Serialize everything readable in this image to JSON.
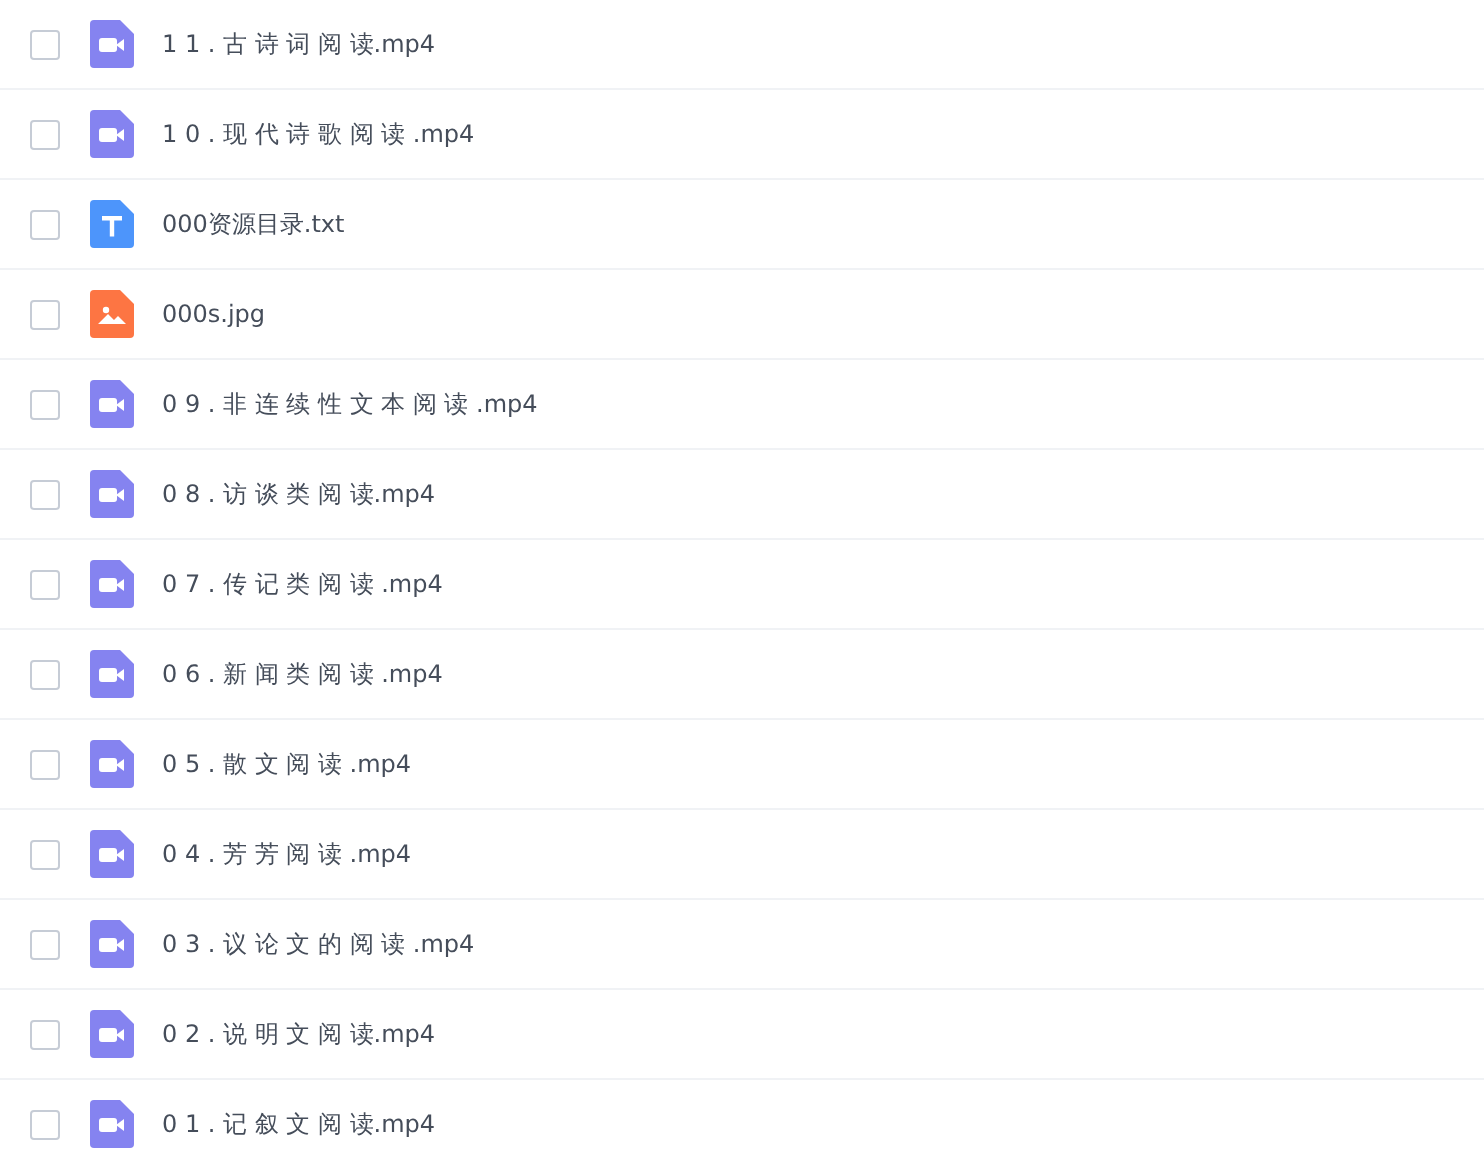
{
  "files": [
    {
      "name": "1 1 . 古 诗 词 阅 读.mp4",
      "kind": "video",
      "checked": false
    },
    {
      "name": "1 0 . 现 代 诗 歌 阅 读 .mp4",
      "kind": "video",
      "checked": false
    },
    {
      "name": "000资源目录.txt",
      "kind": "text",
      "checked": false
    },
    {
      "name": "000s.jpg",
      "kind": "image",
      "checked": false
    },
    {
      "name": "0 9 . 非 连 续 性 文 本 阅 读 .mp4",
      "kind": "video",
      "checked": false
    },
    {
      "name": "0 8 . 访 谈 类 阅 读.mp4",
      "kind": "video",
      "checked": false
    },
    {
      "name": "0 7 . 传 记 类 阅 读 .mp4",
      "kind": "video",
      "checked": false
    },
    {
      "name": "0 6 . 新 闻 类 阅 读 .mp4",
      "kind": "video",
      "checked": false
    },
    {
      "name": "0 5 . 散 文 阅 读 .mp4",
      "kind": "video",
      "checked": false
    },
    {
      "name": "0 4 . 芳 芳 阅 读 .mp4",
      "kind": "video",
      "checked": false
    },
    {
      "name": "0 3 . 议 论 文 的 阅 读 .mp4",
      "kind": "video",
      "checked": false
    },
    {
      "name": "0 2 . 说 明 文 阅 读.mp4",
      "kind": "video",
      "checked": false
    },
    {
      "name": "0 1 . 记 叙 文 阅 读.mp4",
      "kind": "video",
      "checked": false
    }
  ]
}
